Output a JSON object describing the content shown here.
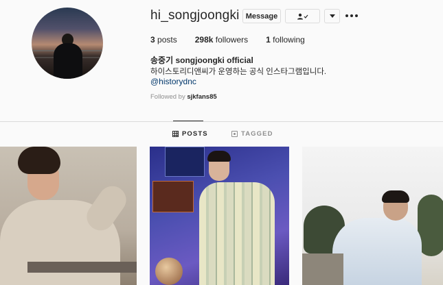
{
  "profile": {
    "username": "hi_songjoongki",
    "full_name": "송중기 songjoongki official",
    "bio": "하이스토리디앤씨가 운영하는 공식 인스타그램입니다.",
    "link": "@historydnc",
    "followed_by_prefix": "Followed by",
    "followed_by_user": "sjkfans85"
  },
  "actions": {
    "message_label": "Message",
    "following_icon": "person-check-icon",
    "dropdown_icon": "triangle-down-icon",
    "more_icon": "more-horizontal-icon"
  },
  "stats": {
    "posts_count": "3",
    "posts_label": "posts",
    "followers_count": "298k",
    "followers_label": "followers",
    "following_count": "1",
    "following_label": "following"
  },
  "tabs": [
    {
      "label": "POSTS",
      "icon": "grid-icon",
      "active": true
    },
    {
      "label": "TAGGED",
      "icon": "tag-icon",
      "active": false
    }
  ],
  "colors": {
    "background": "#fafafa",
    "text": "#262626",
    "secondary_text": "#8e8e8e",
    "link": "#00376b",
    "border": "#dbdbdb"
  }
}
